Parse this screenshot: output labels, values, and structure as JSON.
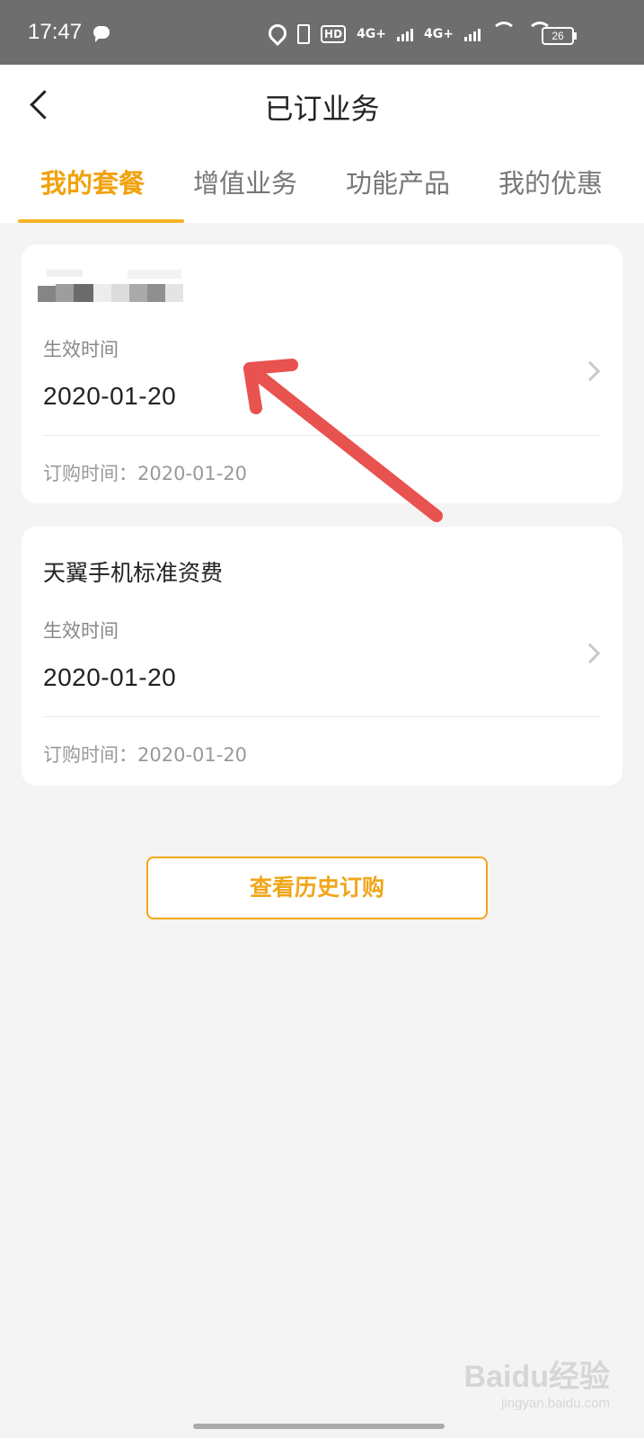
{
  "status_bar": {
    "time": "17:47",
    "hd_badge": "HD",
    "network_1": "4G+",
    "network_2": "4G+",
    "battery": "26"
  },
  "header": {
    "title": "已订业务",
    "tabs": [
      "我的套餐",
      "增值业务",
      "功能产品",
      "我的优惠"
    ],
    "active_tab": 0
  },
  "cards": [
    {
      "title_redacted": true,
      "effective_label": "生效时间",
      "effective_date": "2020-01-20",
      "order_time": "订购时间：2020-01-20"
    },
    {
      "title": "天翼手机标准资费",
      "effective_label": "生效时间",
      "effective_date": "2020-01-20",
      "order_time": "订购时间：2020-01-20"
    }
  ],
  "history_button": "查看历史订购",
  "watermark": {
    "brand": "Baidu经验",
    "url": "jingyan.baidu.com"
  },
  "colors": {
    "accent": "#f1a20d",
    "annotation_arrow": "#e8524f",
    "status_bar": "#6e6e6e"
  }
}
